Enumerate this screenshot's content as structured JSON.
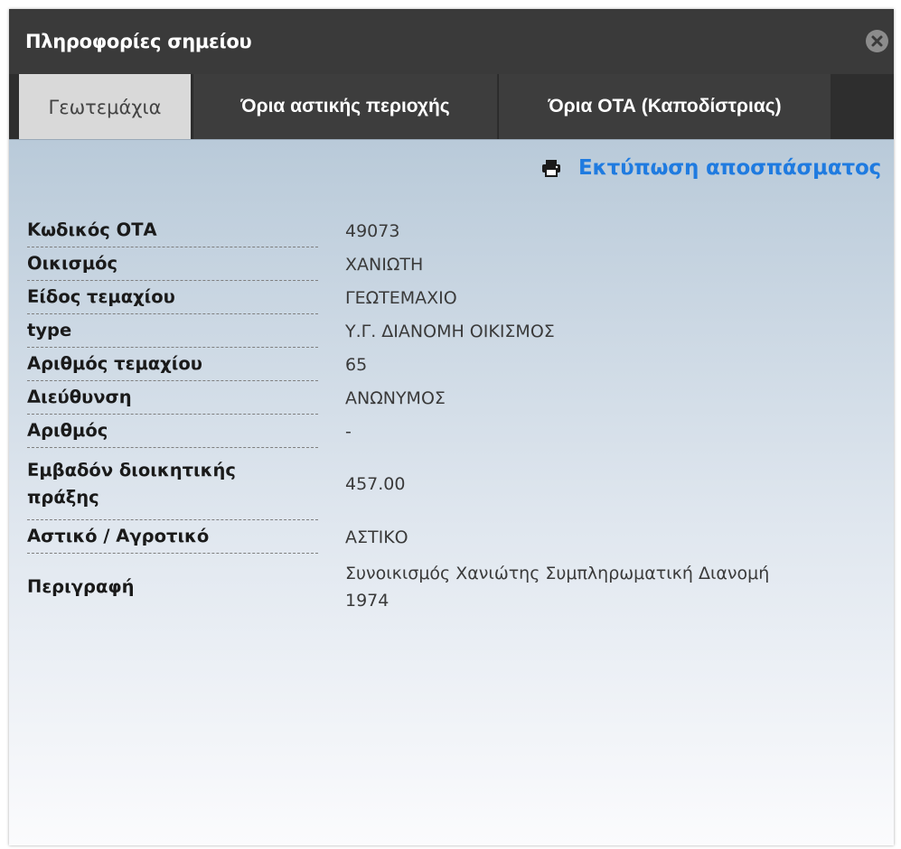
{
  "window": {
    "title": "Πληροφορίες σημείου"
  },
  "tabs": [
    {
      "label": "Γεωτεμάχια",
      "active": true
    },
    {
      "label": "Όρια αστικής περιοχής",
      "active": false
    },
    {
      "label": "Όρια ΟΤΑ (Καποδίστριας)",
      "active": false
    }
  ],
  "print": {
    "label": "Εκτύπωση αποσπάσματος",
    "icon": "printer-icon"
  },
  "fields": [
    {
      "key": "Κωδικός ΟΤΑ",
      "value": "49073"
    },
    {
      "key": "Οικισμός",
      "value": "ΧΑΝΙΩΤΗ"
    },
    {
      "key": "Είδος τεμαχίου",
      "value": "ΓΕΩΤΕΜΑΧΙΟ"
    },
    {
      "key": "type",
      "value": "Υ.Γ. ΔΙΑΝΟΜΗ ΟΙΚΙΣΜΟΣ"
    },
    {
      "key": "Αριθμός τεμαχίου",
      "value": "65"
    },
    {
      "key": "Διεύθυνση",
      "value": "ΑΝΩΝΥΜΟΣ"
    },
    {
      "key": "Αριθμός",
      "value": "-"
    },
    {
      "key": "Εμβαδόν διοικητικής πράξης",
      "value": "457.00"
    },
    {
      "key": "Αστικό / Αγροτικό",
      "value": "ΑΣΤΙΚΟ"
    },
    {
      "key": "Περιγραφή",
      "value": "Συνοικισμός Χανιώτης Συμπληρωματική Διανομή 1974"
    }
  ],
  "colors": {
    "titlebar": "#3a3a3a",
    "active_tab": "#d9d9d9",
    "link": "#1f7be0"
  }
}
